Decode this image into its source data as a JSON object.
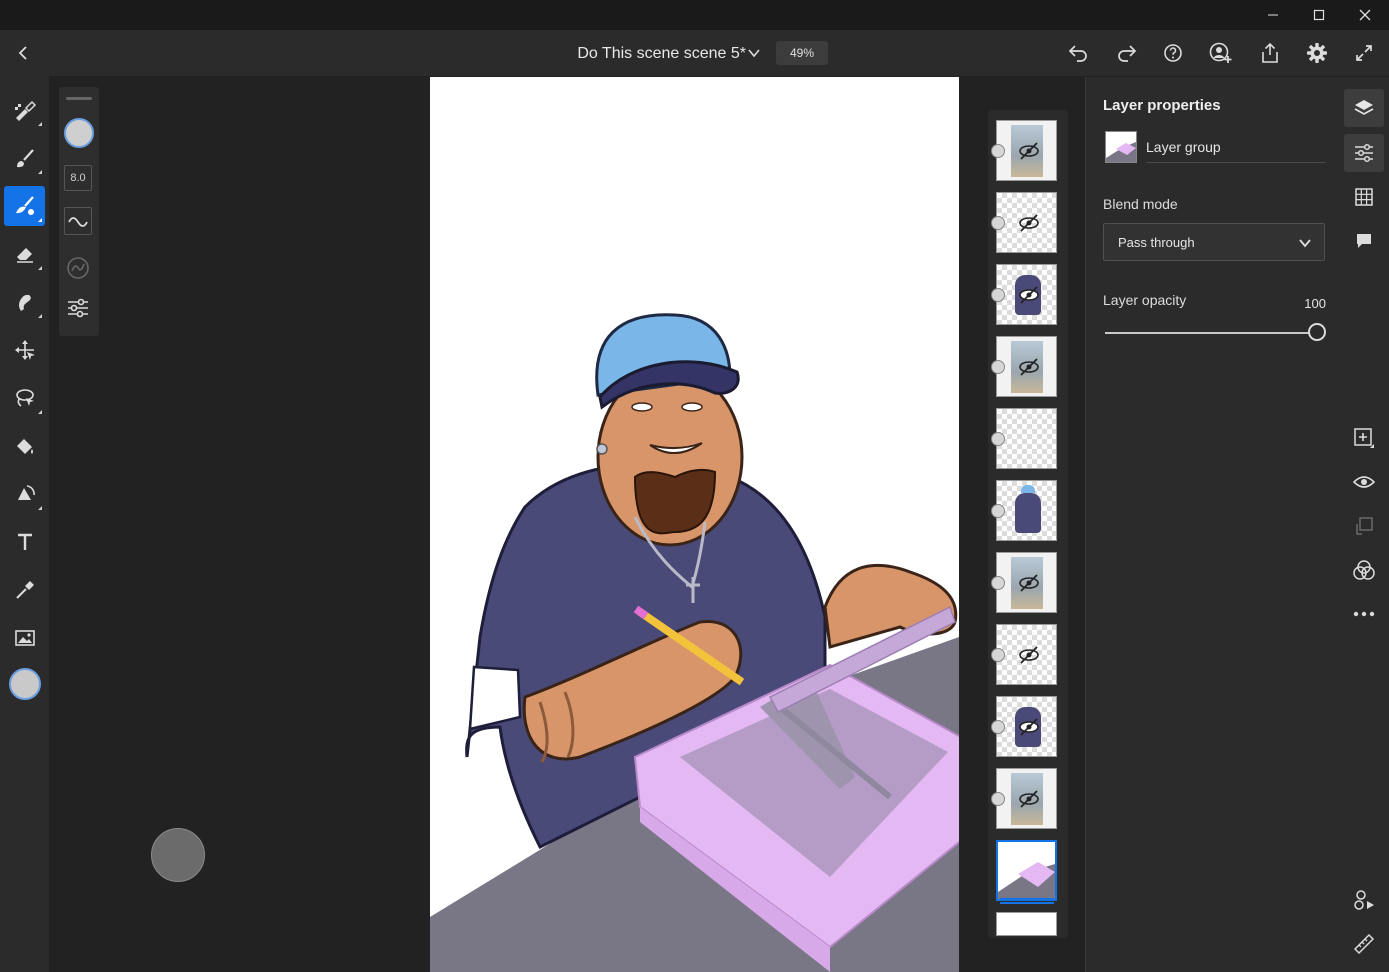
{
  "window": {
    "minimize_icon": "minimize-icon",
    "maximize_icon": "maximize-icon",
    "close_icon": "close-icon"
  },
  "appbar": {
    "document_title": "Do This scene scene 5*",
    "zoom": "49%",
    "icons": [
      "back-icon",
      "chevron-down-icon",
      "undo-icon",
      "redo-icon",
      "help-icon",
      "invite-icon",
      "share-icon",
      "gear-icon",
      "fullscreen-icon"
    ]
  },
  "brush_panel": {
    "size_value": "8.0"
  },
  "layers": [
    {
      "type": "image",
      "hidden": true,
      "selected": false
    },
    {
      "type": "vector",
      "hidden": true,
      "selected": false
    },
    {
      "type": "pixel",
      "hidden": true,
      "selected": false
    },
    {
      "type": "image",
      "hidden": true,
      "selected": false
    },
    {
      "type": "vector",
      "hidden": false,
      "selected": false
    },
    {
      "type": "pixel",
      "hidden": false,
      "selected": false
    },
    {
      "type": "image",
      "hidden": true,
      "selected": false
    },
    {
      "type": "vector",
      "hidden": true,
      "selected": false
    },
    {
      "type": "pixel",
      "hidden": true,
      "selected": false
    },
    {
      "type": "image",
      "hidden": true,
      "selected": false
    },
    {
      "type": "group",
      "hidden": false,
      "selected": true
    }
  ],
  "properties": {
    "title": "Layer properties",
    "layer_name": "Layer group",
    "blend_mode_label": "Blend mode",
    "blend_mode_value": "Pass through",
    "opacity_label": "Layer opacity",
    "opacity_value": "100",
    "opacity_fraction": 1.0
  },
  "colors": {
    "accent": "#1473e6",
    "panel": "#2b2b2b",
    "workspace": "#222222"
  }
}
